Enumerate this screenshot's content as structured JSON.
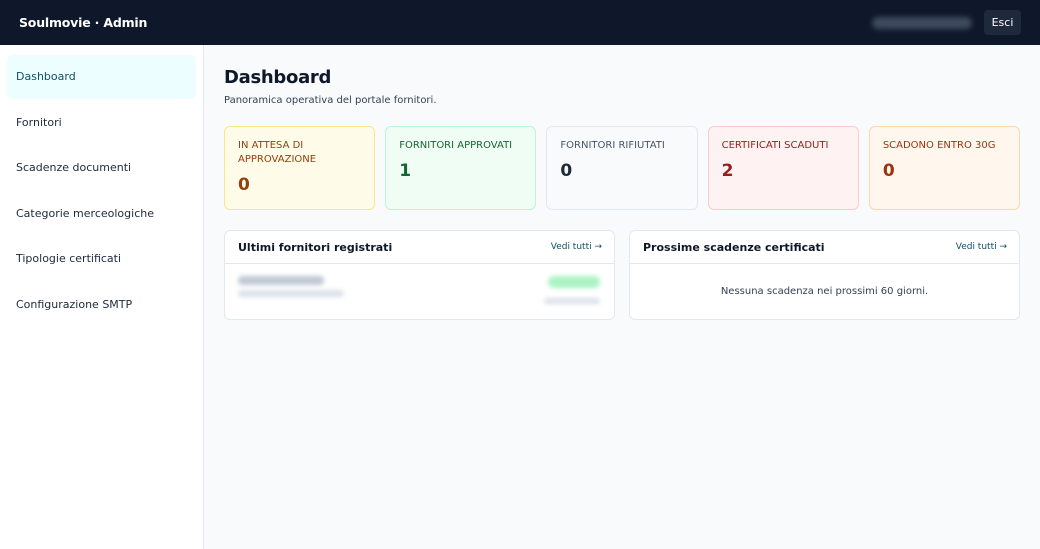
{
  "header": {
    "brand": "Soulmovie · Admin",
    "logout_label": "Esci"
  },
  "sidebar": {
    "items": [
      {
        "label": "Dashboard",
        "active": true
      },
      {
        "label": "Fornitori",
        "active": false
      },
      {
        "label": "Scadenze documenti",
        "active": false
      },
      {
        "label": "Categorie merceologiche",
        "active": false
      },
      {
        "label": "Tipologie certificati",
        "active": false
      },
      {
        "label": "Configurazione SMTP",
        "active": false
      }
    ]
  },
  "main": {
    "title": "Dashboard",
    "subtitle": "Panoramica operativa del portale fornitori.",
    "stats": [
      {
        "label": "IN ATTESA DI APPROVAZIONE",
        "value": "0",
        "color": "#92400e"
      },
      {
        "label": "FORNITORI APPROVATI",
        "value": "1",
        "color": "#166534"
      },
      {
        "label": "FORNITORI RIFIUTATI",
        "value": "0",
        "color": "#475569"
      },
      {
        "label": "CERTIFICATI SCADUTI",
        "value": "2",
        "color": "#991b1b"
      },
      {
        "label": "SCADONO ENTRO 30G",
        "value": "0",
        "color": "#9a3412"
      }
    ],
    "panels": {
      "latest_suppliers": {
        "title": "Ultimi fornitori registrati",
        "link_label": "Vedi tutti →"
      },
      "upcoming_expirations": {
        "title": "Prossime scadenze certificati",
        "link_label": "Vedi tutti →",
        "empty_message": "Nessuna scadenza nei prossimi 60 giorni."
      }
    }
  },
  "colors": {
    "topbar": "#0f172a",
    "accent": "#0e5164",
    "active_bg": "#ecfeff"
  }
}
